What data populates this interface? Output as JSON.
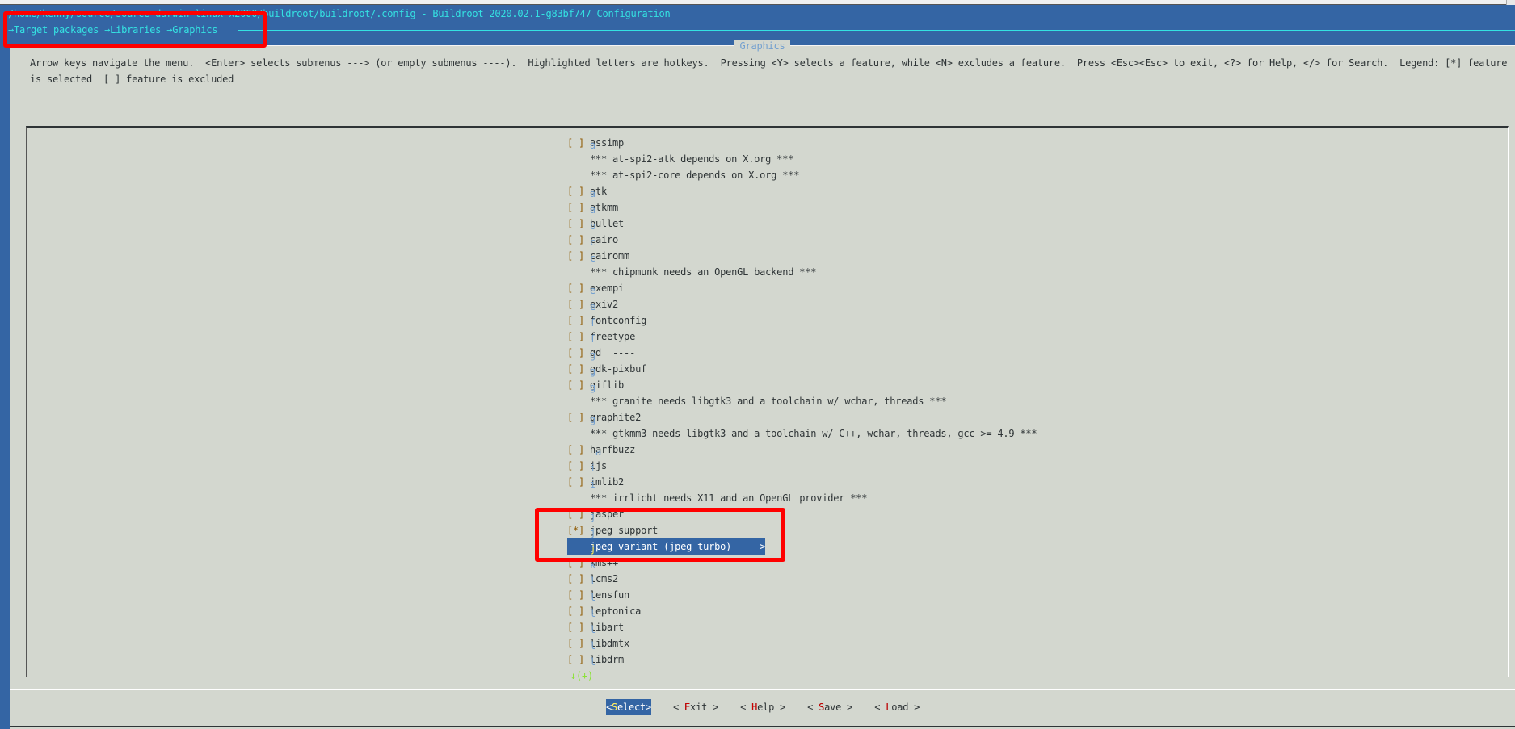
{
  "window": {
    "title": "/home/kenny/source/source_darwin_linux_x2000/buildroot/buildroot/.config - Buildroot 2020.02.1-g83bf747 Configuration",
    "breadcrumb": [
      "Target packages",
      "Libraries",
      "Graphics"
    ],
    "breadcrumb_sep": "→"
  },
  "dialog": {
    "title": "Graphics",
    "help": "Arrow keys navigate the menu.  <Enter> selects submenus ---> (or empty submenus ----).  Highlighted letters are hotkeys.  Pressing <Y> selects a feature, while <N> excludes a feature.  Press <Esc><Esc> to exit, <?> for Help, </> for Search.  Legend: [*] feature is selected  [ ] feature is excluded"
  },
  "menu": {
    "items": [
      {
        "box": "[ ]",
        "label": "assimp",
        "hotkey": 0
      },
      {
        "box": "",
        "label": "*** at-spi2-atk depends on X.org ***",
        "hotkey": -1
      },
      {
        "box": "",
        "label": "*** at-spi2-core depends on X.org ***",
        "hotkey": -1
      },
      {
        "box": "[ ]",
        "label": "atk",
        "hotkey": 0
      },
      {
        "box": "[ ]",
        "label": "atkmm",
        "hotkey": 0
      },
      {
        "box": "[ ]",
        "label": "bullet",
        "hotkey": 0
      },
      {
        "box": "[ ]",
        "label": "cairo",
        "hotkey": 0
      },
      {
        "box": "[ ]",
        "label": "cairomm",
        "hotkey": 0
      },
      {
        "box": "",
        "label": "*** chipmunk needs an OpenGL backend ***",
        "hotkey": -1
      },
      {
        "box": "[ ]",
        "label": "exempi",
        "hotkey": 0
      },
      {
        "box": "[ ]",
        "label": "exiv2",
        "hotkey": 0
      },
      {
        "box": "[ ]",
        "label": "fontconfig",
        "hotkey": 0
      },
      {
        "box": "[ ]",
        "label": "freetype",
        "hotkey": 0
      },
      {
        "box": "[ ]",
        "label": "gd  ----",
        "hotkey": 0
      },
      {
        "box": "[ ]",
        "label": "gdk-pixbuf",
        "hotkey": 0
      },
      {
        "box": "[ ]",
        "label": "giflib",
        "hotkey": 0
      },
      {
        "box": "",
        "label": "*** granite needs libgtk3 and a toolchain w/ wchar, threads ***",
        "hotkey": -1
      },
      {
        "box": "[ ]",
        "label": "graphite2",
        "hotkey": 0
      },
      {
        "box": "",
        "label": "*** gtkmm3 needs libgtk3 and a toolchain w/ C++, wchar, threads, gcc >= 4.9 ***",
        "hotkey": -1
      },
      {
        "box": "[ ]",
        "label": "harfbuzz",
        "hotkey": 1
      },
      {
        "box": "[ ]",
        "label": "ijs",
        "hotkey": 0
      },
      {
        "box": "[ ]",
        "label": "imlib2",
        "hotkey": 0
      },
      {
        "box": "",
        "label": "*** irrlicht needs X11 and an OpenGL provider ***",
        "hotkey": -1
      },
      {
        "box": "[ ]",
        "label": "jasper",
        "hotkey": 0
      },
      {
        "box": "[*]",
        "label": "jpeg support",
        "hotkey": 0
      },
      {
        "box": "",
        "label": "jpeg variant (jpeg-turbo)  --->",
        "hotkey": 0,
        "selected": true
      },
      {
        "box": "[ ]",
        "label": "kms++",
        "hotkey": 0
      },
      {
        "box": "[ ]",
        "label": "lcms2",
        "hotkey": 0
      },
      {
        "box": "[ ]",
        "label": "lensfun",
        "hotkey": 0
      },
      {
        "box": "[ ]",
        "label": "leptonica",
        "hotkey": 0
      },
      {
        "box": "[ ]",
        "label": "libart",
        "hotkey": 0
      },
      {
        "box": "[ ]",
        "label": "libdmtx",
        "hotkey": 0
      },
      {
        "box": "[ ]",
        "label": "libdrm  ----",
        "hotkey": 0
      }
    ],
    "more_indicator": "↓(+)"
  },
  "buttons": [
    {
      "label": "<Select>",
      "hotkey": 1,
      "active": true
    },
    {
      "label": "< Exit >",
      "hotkey": 2
    },
    {
      "label": "< Help >",
      "hotkey": 2
    },
    {
      "label": "< Save >",
      "hotkey": 2
    },
    {
      "label": "< Load >",
      "hotkey": 2
    }
  ],
  "colors": {
    "background": "#3465a4",
    "dialog": "#d3d7cf",
    "hotkey": "#729fcf",
    "button_hotkey": "#cc0000",
    "annotation": "#ff0000"
  }
}
